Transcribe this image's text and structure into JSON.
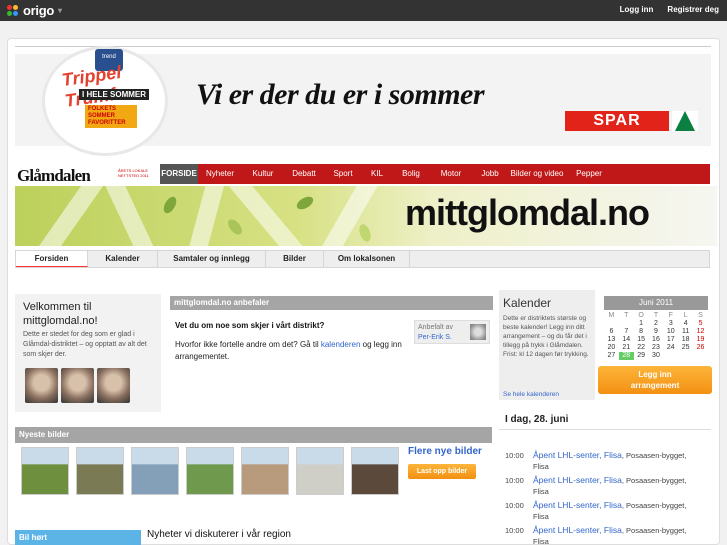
{
  "topbar": {
    "brand": "origo",
    "login": "Logg inn",
    "register": "Registrer deg"
  },
  "ad": {
    "badge_brand": "trend",
    "badge_title": "Trippel Trumf",
    "badge_line1": "I HELE SOMMER",
    "badge_line2": "FOLKETS SOMMER FAVORITTER",
    "slogan": "Vi er der du er i sommer",
    "spar": "SPAR"
  },
  "masthead": {
    "name": "Glåmdalen",
    "award": "ÅRETS LOKALE NETTSTED 2011"
  },
  "nav": [
    {
      "label": "FORSIDE",
      "active": true
    },
    {
      "label": "Nyheter"
    },
    {
      "label": "Kultur"
    },
    {
      "label": "Debatt"
    },
    {
      "label": "Sport"
    },
    {
      "label": "KIL"
    },
    {
      "label": "Bolig"
    },
    {
      "label": "Motor"
    },
    {
      "label": "Jobb"
    },
    {
      "label": "Bilder og video"
    },
    {
      "label": "Pepper"
    }
  ],
  "banner": {
    "text": "mittglomdal.no"
  },
  "subnav": [
    {
      "label": "Forsiden",
      "active": true
    },
    {
      "label": "Kalender"
    },
    {
      "label": "Samtaler og innlegg"
    },
    {
      "label": "Bilder"
    },
    {
      "label": "Om lokalsonen"
    }
  ],
  "welcome": {
    "title": "Velkommen til mittglomdal.no!",
    "text": "Dette er stedet for deg som er glad i Glåmdal-distriktet – og opptatt av alt det som skjer der."
  },
  "recommend": {
    "header": "mittglomdal.no anbefaler",
    "question": "Vet du om noe som skjer i vårt distrikt?",
    "text_before": "Hvorfor ikke fortelle andre om det? Gå til ",
    "link": "kalenderen",
    "text_after": " og legg inn arrangementet.",
    "by_label": "Anbefalt av",
    "by_name": "Per-Erik S."
  },
  "kalender": {
    "title": "Kalender",
    "text": "Dette er distriktets største og beste kalender! Legg inn ditt arrangement – og du får det i tillegg på trykk i Glåmdalen. Frist: kl 12 dagen før trykking.",
    "see_all": "Se hele kalenderen",
    "button": "Legg inn arrangement"
  },
  "calendar": {
    "month": "Juni 2011",
    "days": [
      "M",
      "T",
      "O",
      "T",
      "F",
      "L",
      "S"
    ],
    "weeks": [
      [
        "",
        "",
        "1",
        "2",
        "3",
        "4",
        "5"
      ],
      [
        "6",
        "7",
        "8",
        "9",
        "10",
        "11",
        "12"
      ],
      [
        "13",
        "14",
        "15",
        "16",
        "17",
        "18",
        "19"
      ],
      [
        "20",
        "21",
        "22",
        "23",
        "24",
        "25",
        "26"
      ],
      [
        "27",
        "28",
        "29",
        "30",
        "",
        "",
        ""
      ]
    ],
    "today": "28"
  },
  "idag": {
    "title": "I dag, 28. juni",
    "events": [
      {
        "time": "10:00",
        "title": "Åpent LHL-senter",
        "place": "Flisa",
        "venue": "Posaasen-bygget, Flisa"
      },
      {
        "time": "10:00",
        "title": "Åpent LHL-senter",
        "place": "Flisa",
        "venue": "Posaasen-bygget, Flisa"
      },
      {
        "time": "10:00",
        "title": "Åpent LHL-senter",
        "place": "Flisa",
        "venue": "Posaasen-bygget, Flisa"
      },
      {
        "time": "10:00",
        "title": "Åpent LHL-senter",
        "place": "Flisa",
        "venue": "Posaasen-bygget, Flisa"
      }
    ]
  },
  "photos": {
    "header": "Nyeste bilder",
    "more": "Flere nye bilder",
    "upload": "Last opp bilder",
    "colors": [
      "#6d8f3e",
      "#7a7a55",
      "#84a0b8",
      "#6f9a4e",
      "#b89a7c",
      "#cfcfc8",
      "#5b4a3c"
    ]
  },
  "bottom": {
    "heard": "Bil hørt",
    "news": "Nyheter vi diskuterer i vår region"
  }
}
